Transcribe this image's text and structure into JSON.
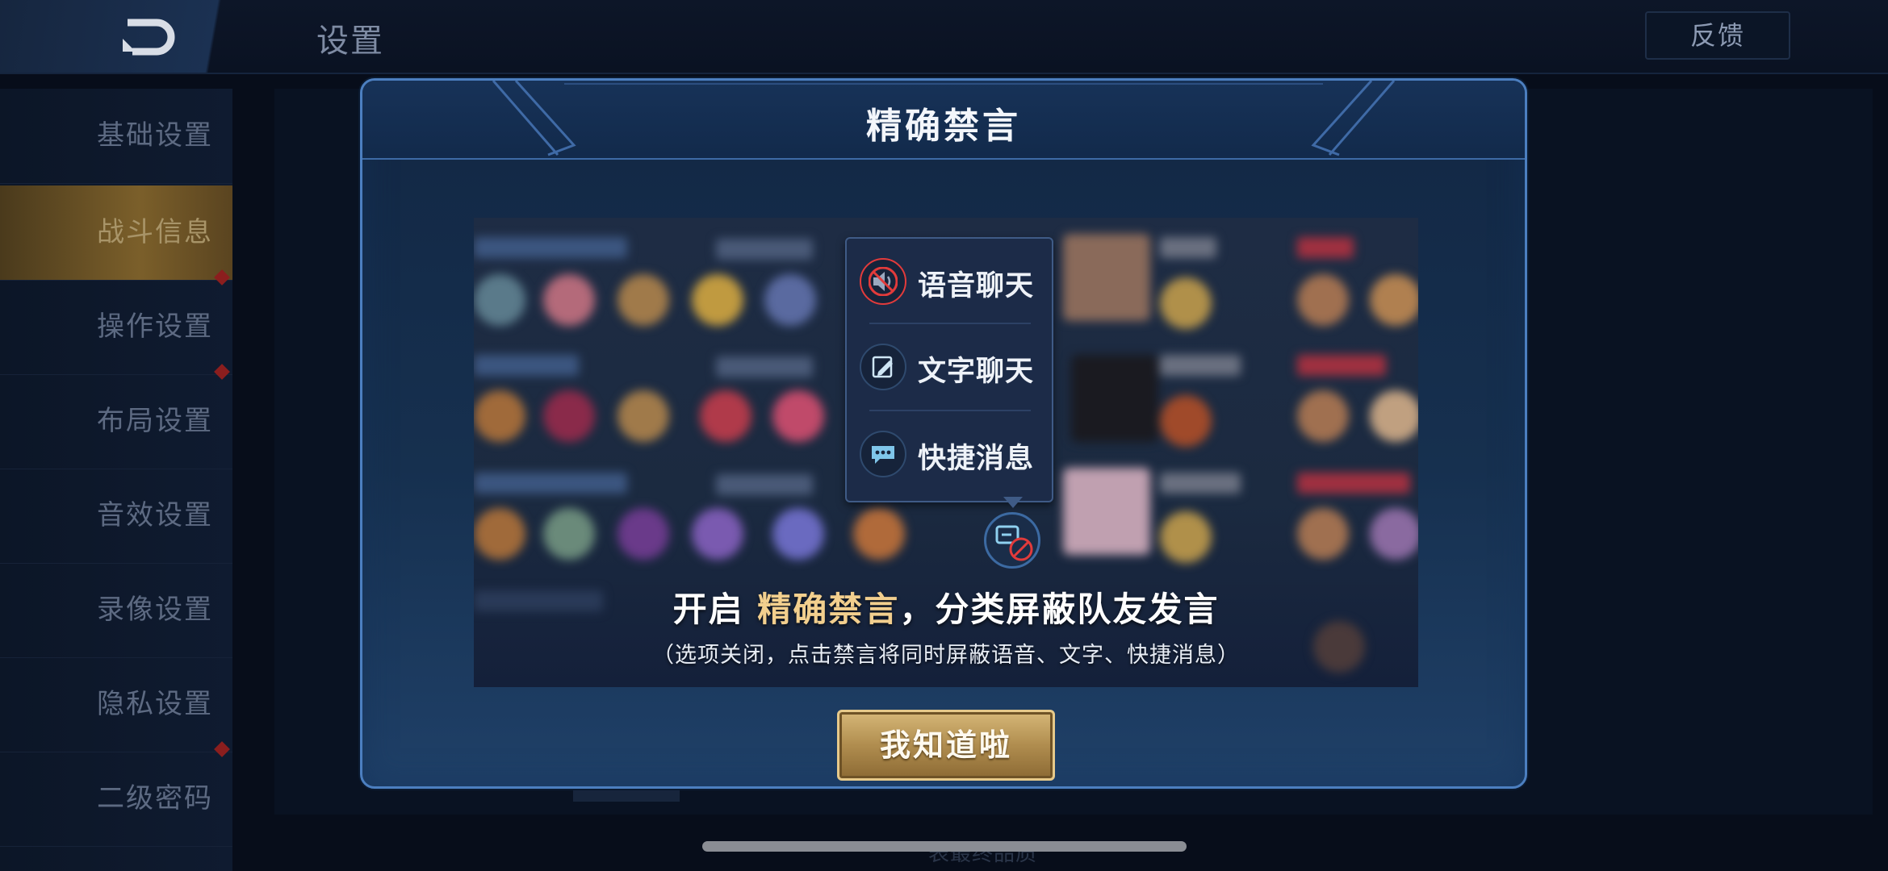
{
  "header": {
    "title": "设置",
    "feedback_label": "反馈"
  },
  "sidebar": {
    "items": [
      {
        "label": "基础设置",
        "active": false,
        "dot": false
      },
      {
        "label": "战斗信息",
        "active": true,
        "dot": false
      },
      {
        "label": "操作设置",
        "active": false,
        "dot": true
      },
      {
        "label": "布局设置",
        "active": false,
        "dot": true
      },
      {
        "label": "音效设置",
        "active": false,
        "dot": false
      },
      {
        "label": "录像设置",
        "active": false,
        "dot": false
      },
      {
        "label": "隐私设置",
        "active": false,
        "dot": false
      },
      {
        "label": "二级密码",
        "active": false,
        "dot": true
      }
    ]
  },
  "background_footer": "表最终品质",
  "dialog": {
    "title": "精确禁言",
    "popup": {
      "items": [
        {
          "label": "语音聊天",
          "icon": "voice-muted-icon"
        },
        {
          "label": "文字聊天",
          "icon": "text-edit-icon"
        },
        {
          "label": "快捷消息",
          "icon": "quick-message-icon"
        }
      ]
    },
    "caption_prefix": "开启 ",
    "caption_highlight": "精确禁言",
    "caption_suffix": "，分类屏蔽队友发言",
    "subcaption": "（选项关闭，点击禁言将同时屏蔽语音、文字、快捷消息）",
    "confirm_label": "我知道啦"
  },
  "colors": {
    "accent_gold": "#d6b778",
    "highlight_text": "#f2cf8e",
    "dialog_border": "#4c7fc0",
    "mute_red": "#e23b3b"
  }
}
